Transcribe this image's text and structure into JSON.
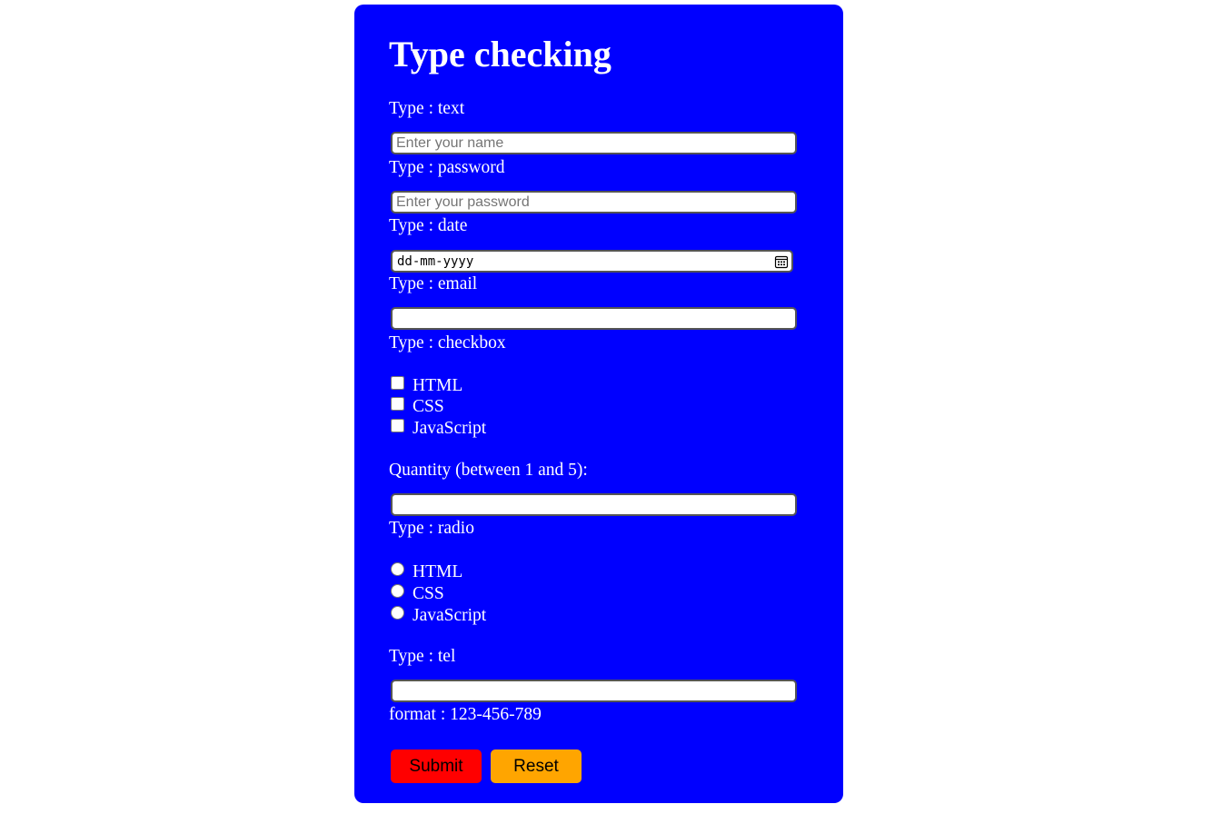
{
  "form": {
    "title": "Type checking",
    "text": {
      "label": "Type : text",
      "placeholder": "Enter your name",
      "value": ""
    },
    "password": {
      "label": "Type : password",
      "placeholder": "Enter your password",
      "value": ""
    },
    "date": {
      "label": "Type : date",
      "display": "dd-mm-yyyy",
      "icon": "calendar-icon"
    },
    "email": {
      "label": "Type : email",
      "value": ""
    },
    "checkbox": {
      "label": "Type : checkbox",
      "options": [
        {
          "label": "HTML",
          "checked": false
        },
        {
          "label": "CSS",
          "checked": false
        },
        {
          "label": "JavaScript",
          "checked": false
        }
      ]
    },
    "quantity": {
      "label": "Quantity (between 1 and 5):",
      "value": ""
    },
    "radio": {
      "label": "Type : radio",
      "options": [
        {
          "label": "HTML",
          "checked": false
        },
        {
          "label": "CSS",
          "checked": false
        },
        {
          "label": "JavaScript",
          "checked": false
        }
      ]
    },
    "tel": {
      "label": "Type : tel",
      "value": "",
      "format": "format : 123-456-789"
    },
    "buttons": {
      "submit": "Submit",
      "reset": "Reset"
    }
  },
  "colors": {
    "card_background": "#0000ff",
    "text": "#ffffff",
    "submit_button": "#ff0000",
    "reset_button": "#ffa500"
  }
}
